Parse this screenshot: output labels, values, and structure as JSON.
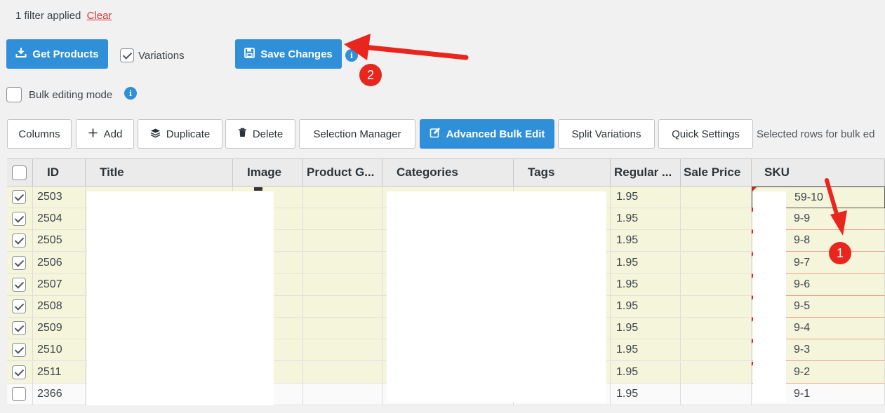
{
  "filter": {
    "text": "1 filter applied",
    "clear_label": "Clear"
  },
  "actions": {
    "get_products": "Get Products",
    "variations_label": "Variations",
    "variations_checked": true,
    "save_changes": "Save Changes",
    "bulk_editing_label": "Bulk editing mode",
    "bulk_editing_checked": false
  },
  "toolbar": {
    "columns": "Columns",
    "add": "Add",
    "duplicate": "Duplicate",
    "delete": "Delete",
    "selection_manager": "Selection Manager",
    "advanced_bulk_edit": "Advanced Bulk Edit",
    "split_variations": "Split Variations",
    "quick_settings": "Quick Settings",
    "selected_rows_text": "Selected rows for bulk ed"
  },
  "table": {
    "headers": {
      "id": "ID",
      "title": "Title",
      "image": "Image",
      "product_gallery": "Product G...",
      "categories": "Categories",
      "tags": "Tags",
      "regular_price": "Regular ...",
      "sale_price": "Sale Price",
      "sku": "SKU"
    },
    "rows": [
      {
        "checked": true,
        "id": "2503",
        "regular_price": "1.95",
        "sku": "59-10"
      },
      {
        "checked": true,
        "id": "2504",
        "regular_price": "1.95",
        "sku": "9-9"
      },
      {
        "checked": true,
        "id": "2505",
        "regular_price": "1.95",
        "sku": "9-8"
      },
      {
        "checked": true,
        "id": "2506",
        "regular_price": "1.95",
        "sku": "9-7"
      },
      {
        "checked": true,
        "id": "2507",
        "regular_price": "1.95",
        "sku": "9-6"
      },
      {
        "checked": true,
        "id": "2508",
        "regular_price": "1.95",
        "sku": "9-5"
      },
      {
        "checked": true,
        "id": "2509",
        "regular_price": "1.95",
        "sku": "9-4"
      },
      {
        "checked": true,
        "id": "2510",
        "regular_price": "1.95",
        "sku": "9-3"
      },
      {
        "checked": true,
        "id": "2511",
        "regular_price": "1.95",
        "sku": "9-2"
      },
      {
        "checked": false,
        "id": "2366",
        "regular_price": "1.95",
        "sku": "9-1"
      }
    ]
  },
  "annotations": {
    "badge_1": "1",
    "badge_2": "2",
    "arrow_color": "#e8261d"
  },
  "icons": {
    "get_products": "download-tray-icon",
    "save_changes": "floppy-disk-icon",
    "add": "plus-icon",
    "duplicate": "layers-icon",
    "delete": "trash-icon",
    "advanced_bulk_edit": "edit-icon"
  },
  "colors": {
    "primary": "#2f8fd8",
    "selected_row": "#f5f5dc",
    "danger": "#d63638"
  }
}
